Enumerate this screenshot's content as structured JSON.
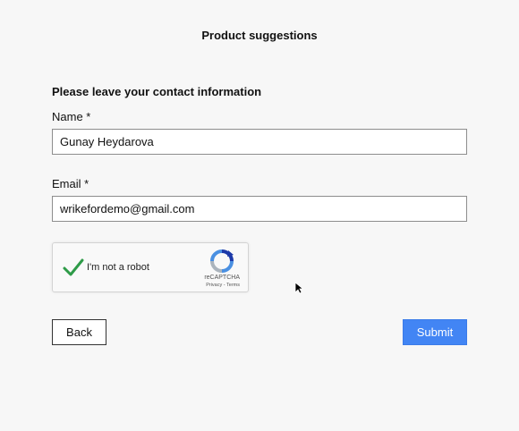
{
  "header": {
    "title": "Product suggestions"
  },
  "form": {
    "section_heading": "Please leave your contact information",
    "name": {
      "label": "Name *",
      "value": "Gunay Heydarova"
    },
    "email": {
      "label": "Email *",
      "value": "wrikefordemo@gmail.com"
    }
  },
  "recaptcha": {
    "label": "I'm not a robot",
    "checked": true,
    "brand": "reCAPTCHA",
    "privacy": "Privacy",
    "separator": " - ",
    "terms": "Terms",
    "check_color": "#2e9b48",
    "icon": "recaptcha-logo-icon"
  },
  "actions": {
    "back_label": "Back",
    "submit_label": "Submit",
    "submit_color": "#4285f4"
  }
}
